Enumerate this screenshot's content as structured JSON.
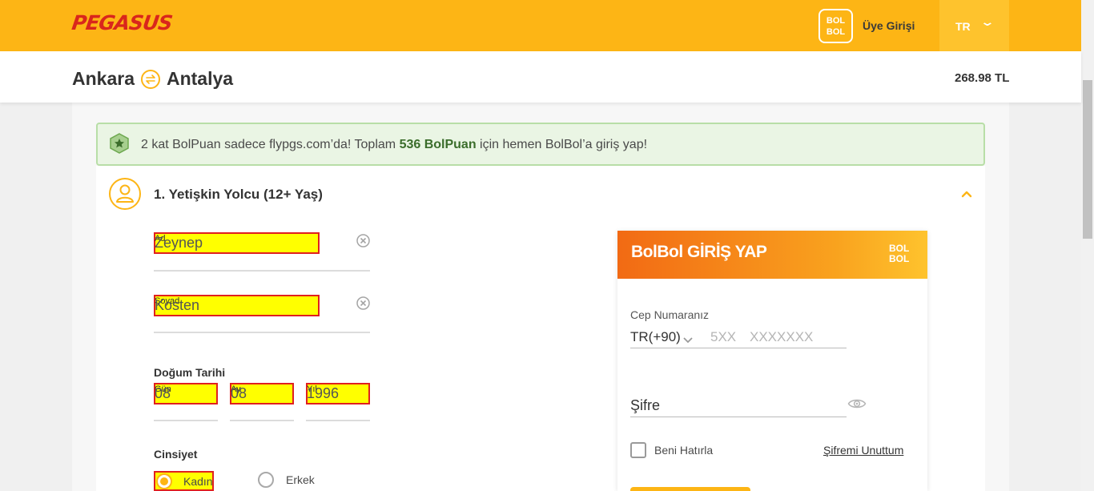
{
  "header": {
    "logo_text": "PEGASUS",
    "bolbol_badge": "BOL BOL",
    "login_label": "Üye Girişi",
    "language": "TR"
  },
  "route": {
    "origin": "Ankara",
    "destination": "Antalya",
    "price": "268.98 TL"
  },
  "banner": {
    "text_before": "2 kat BolPuan sadece flypgs.com’da! Toplam ",
    "points": "536 BolPuan",
    "text_after": " için hemen BolBol’a giriş yap!"
  },
  "passenger": {
    "title": "1. Yetişkin Yolcu (12+ Yaş)",
    "first_name_label": "Ad",
    "first_name_value": "Zeynep",
    "last_name_label": "Soyad",
    "last_name_value": "Kosten",
    "dob_title": "Doğum Tarihi",
    "day_label": "Gün",
    "day_value": "08",
    "month_label": "Ay",
    "month_value": "08",
    "year_label": "Yıl",
    "year_value": "1996",
    "gender_title": "Cinsiyet",
    "gender_options": [
      "Kadın",
      "Erkek"
    ],
    "gender_selected": "Kadın"
  },
  "bolbol_login": {
    "title": "BolBol GİRİŞ YAP",
    "logo": "BOL BOL",
    "phone_label": "Cep Numaranız",
    "country_code": "TR(+90)",
    "phone_placeholder_1": "5XX",
    "phone_placeholder_2": "XXXXXXX",
    "password_label": "Şifre",
    "remember_label": "Beni Hatırla",
    "forgot_label": "Şifremi Unuttum"
  },
  "colors": {
    "brand_yellow": "#fdb515",
    "brand_red": "#d9261c",
    "banner_green": "#eaf5e4",
    "highlight": "#ffff00"
  }
}
